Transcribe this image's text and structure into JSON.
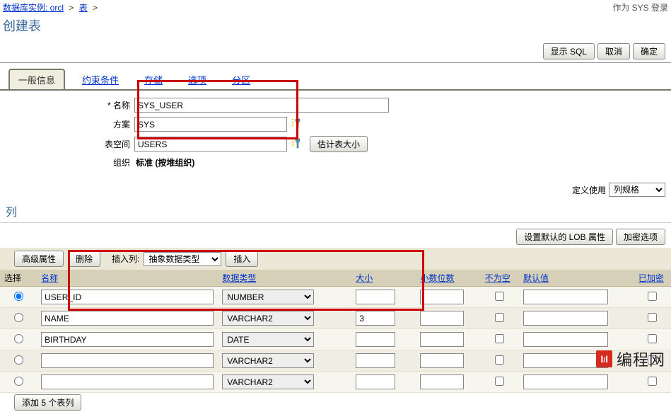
{
  "breadcrumb": {
    "db_instance_label": "数据库实例: orcl",
    "table_label": "表",
    "login_text": "作为 SYS 登录"
  },
  "page_title": "创建表",
  "top_buttons": {
    "show_sql": "显示 SQL",
    "cancel": "取消",
    "ok": "确定"
  },
  "tabs": {
    "general": "一般信息",
    "constraints": "约束条件",
    "storage": "存储",
    "options": "选项",
    "partition": "分区"
  },
  "form": {
    "name_label": "* 名称",
    "name_value": "SYS_USER",
    "schema_label": "方案",
    "schema_value": "SYS",
    "tablespace_label": "表空间",
    "tablespace_value": "USERS",
    "estimate_btn": "估计表大小",
    "org_label": "组织",
    "org_value": "标准 (按堆组织)"
  },
  "define_usage": {
    "label": "定义使用",
    "value": "列规格"
  },
  "columns_section_title": "列",
  "lob_buttons": {
    "set_lob": "设置默认的 LOB 属性",
    "enc_opts": "加密选项"
  },
  "toolbar": {
    "advanced": "高级属性",
    "delete": "删除",
    "insert_col_label": "插入列:",
    "insert_type": "抽象数据类型",
    "insert_btn": "插入"
  },
  "headers": {
    "select": "选择",
    "name": "名称",
    "datatype": "数据类型",
    "size": "大小",
    "scale": "小数位数",
    "notnull": "不为空",
    "default": "默认值",
    "encrypted": "已加密"
  },
  "rows": [
    {
      "name": "USER_ID",
      "type": "NUMBER",
      "size": "",
      "scale": "",
      "notnull": false
    },
    {
      "name": "NAME",
      "type": "VARCHAR2",
      "size": "3",
      "scale": "",
      "notnull": false
    },
    {
      "name": "BIRTHDAY",
      "type": "DATE",
      "size": "",
      "scale": "",
      "notnull": false
    },
    {
      "name": "",
      "type": "VARCHAR2",
      "size": "",
      "scale": "",
      "notnull": false
    },
    {
      "name": "",
      "type": "VARCHAR2",
      "size": "",
      "scale": "",
      "notnull": false
    }
  ],
  "add_rows_btn": "添加 5 个表列",
  "logo_text": "编程网"
}
